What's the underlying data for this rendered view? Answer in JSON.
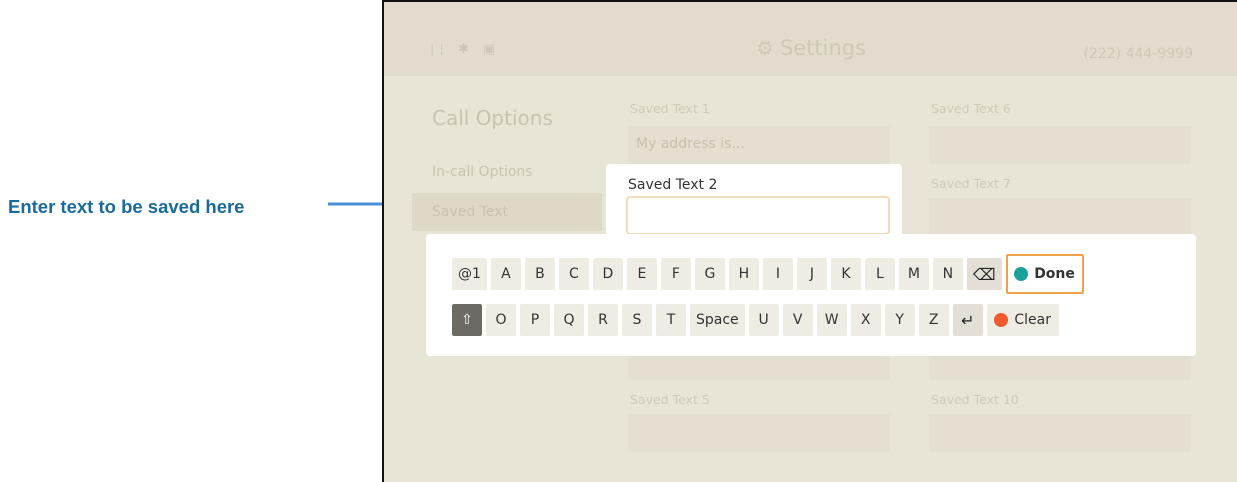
{
  "annotation": {
    "callout": "Enter text to be saved here"
  },
  "topbar": {
    "status_icons": "¦¦ ✱ ▣",
    "title": "Settings",
    "phone": "(222) 444-9999"
  },
  "sidebar": {
    "title": "Call Options",
    "items": [
      {
        "label": "In-call Options"
      },
      {
        "label": "Saved Text"
      }
    ]
  },
  "fields_left": [
    {
      "label": "Saved Text 1",
      "value": "My address is..."
    },
    {
      "label": "Saved Text 5",
      "value": ""
    }
  ],
  "fields_right": [
    {
      "label": "Saved Text 6",
      "value": ""
    },
    {
      "label": "Saved Text 7",
      "value": ""
    },
    {
      "label": "Saved Text 10",
      "value": ""
    }
  ],
  "popup": {
    "label": "Saved Text 2",
    "value": ""
  },
  "keyboard": {
    "row1": [
      "@1",
      "A",
      "B",
      "C",
      "D",
      "E",
      "F",
      "G",
      "H",
      "I",
      "J",
      "K",
      "L",
      "M",
      "N"
    ],
    "row2": [
      "O",
      "P",
      "Q",
      "R",
      "S",
      "T",
      "Space",
      "U",
      "V",
      "W",
      "X",
      "Y",
      "Z"
    ],
    "done_label": "Done",
    "clear_label": "Clear",
    "done_color": "#1aa39a",
    "clear_color": "#ef5b2c"
  }
}
